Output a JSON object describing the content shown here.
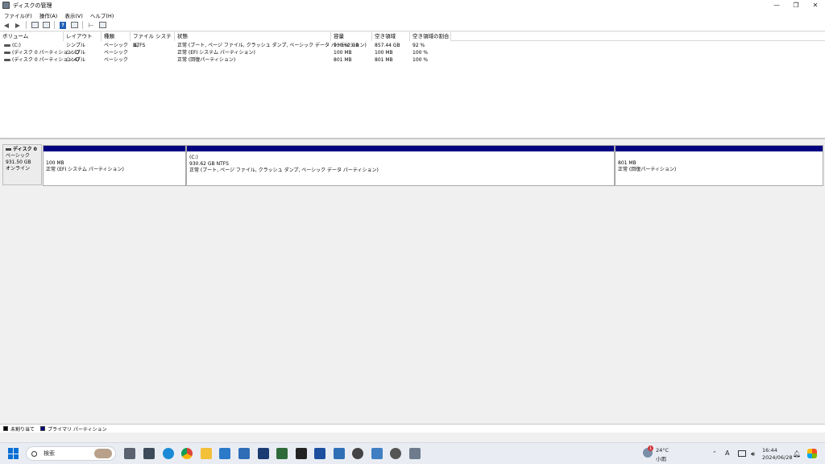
{
  "window": {
    "title": "ディスクの管理",
    "controls": [
      "—",
      "❐",
      "✕"
    ]
  },
  "menu": [
    "ファイル(F)",
    "操作(A)",
    "表示(V)",
    "ヘルプ(H)"
  ],
  "volume_table": {
    "columns": [
      "ボリューム",
      "レイアウト",
      "種類",
      "ファイル システム",
      "状態",
      "容量",
      "空き領域",
      "空き領域の割合"
    ],
    "rows": [
      [
        "(C:)",
        "シンプル",
        "ベーシック",
        "NTFS",
        "正常 (ブート, ページ ファイル, クラッシュ ダンプ, ベーシック データ パーティション)",
        "930.62 GB",
        "857.44 GB",
        "92 %"
      ],
      [
        "(ディスク 0 パーティション 1)",
        "シンプル",
        "ベーシック",
        "",
        "正常 (EFI システム パーティション)",
        "100 MB",
        "100 MB",
        "100 %"
      ],
      [
        "(ディスク 0 パーティション 4)",
        "シンプル",
        "ベーシック",
        "",
        "正常 (回復パーティション)",
        "801 MB",
        "801 MB",
        "100 %"
      ]
    ]
  },
  "disk": {
    "name": "ディスク 0",
    "type": "ベーシック",
    "size": "931.50 GB",
    "state": "オンライン",
    "partitions": [
      {
        "label": "",
        "size": "100 MB",
        "status": "正常 (EFI システム パーティション)"
      },
      {
        "label": "(C:)",
        "size": "930.62 GB NTFS",
        "status": "正常 (ブート, ページ ファイル, クラッシュ ダンプ, ベーシック データ パーティション)"
      },
      {
        "label": "",
        "size": "801 MB",
        "status": "正常 (回復パーティション)"
      }
    ]
  },
  "legend": [
    {
      "label": "未割り当て",
      "color": "#000000"
    },
    {
      "label": "プライマリ パーティション",
      "color": "#000080"
    }
  ],
  "taskbar": {
    "search_placeholder": "検索",
    "weather_temp": "24°C",
    "weather_desc": "小雨",
    "ime": "A",
    "time": "16:44",
    "date": "2024/06/28",
    "weather_badge": "1"
  },
  "colors": {
    "partition_bar": "#000080",
    "taskbar_bg": "#e9edf3",
    "accent": "#0a6fd4"
  }
}
